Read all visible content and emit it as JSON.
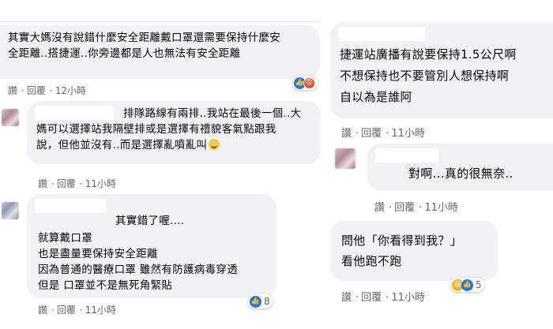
{
  "comments_left": [
    {
      "lines": [
        "其實大媽沒有說錯什麼安全距離戴口罩還需要保持什麼安",
        "全距離..搭捷運..你旁邊都是人也無法有安全距離"
      ],
      "meta": {
        "like": "讚",
        "reply": "回覆",
        "time": "12小時"
      },
      "reactions": [
        "like",
        "angry"
      ]
    },
    {
      "lines": [
        "排隊路線有兩排..我站在最後一個..大",
        "媽可以選擇站我隔壁排或是選擇有禮貌客氣點跟我",
        "說，但他並沒有..而是選擇亂噴亂叫"
      ],
      "meta": {
        "like": "讚",
        "reply": "回覆",
        "time": "11小時"
      }
    },
    {
      "lines": [
        "其實錯了喔....",
        "就算戴口罩",
        "也是盡量要保持安全距離",
        "因為普通的醫療口罩 雖然有防護病毒穿透",
        "但是 口罩並不是無死角緊貼"
      ],
      "meta": {
        "like": "讚",
        "reply": "回覆",
        "time": "11小時"
      },
      "reactions": [
        "like"
      ],
      "reaction_count": "8"
    }
  ],
  "comments_right": [
    {
      "lines": [
        "捷運站廣播有說要保持1.5公尺啊",
        "不想保持也不要管別人想保持啊",
        "自以為是誰阿"
      ],
      "meta": {
        "like": "讚",
        "reply": "回覆",
        "time": "11小時"
      }
    },
    {
      "lines": [
        "對啊…真的很無奈.."
      ],
      "meta": {
        "like": "讚",
        "reply": "回覆",
        "time": "11小時"
      }
    },
    {
      "lines": [
        "問他「你看得到我？」",
        "看他跑不跑"
      ],
      "meta": {
        "like": "讚",
        "reply": "回覆",
        "time": "11小時"
      },
      "reactions": [
        "haha",
        "like"
      ],
      "reaction_count": "5"
    }
  ],
  "sep": "·",
  "colors": {
    "bubble": "#f0f2f5",
    "meta": "#65676b",
    "like_blue": "#1877f2"
  }
}
